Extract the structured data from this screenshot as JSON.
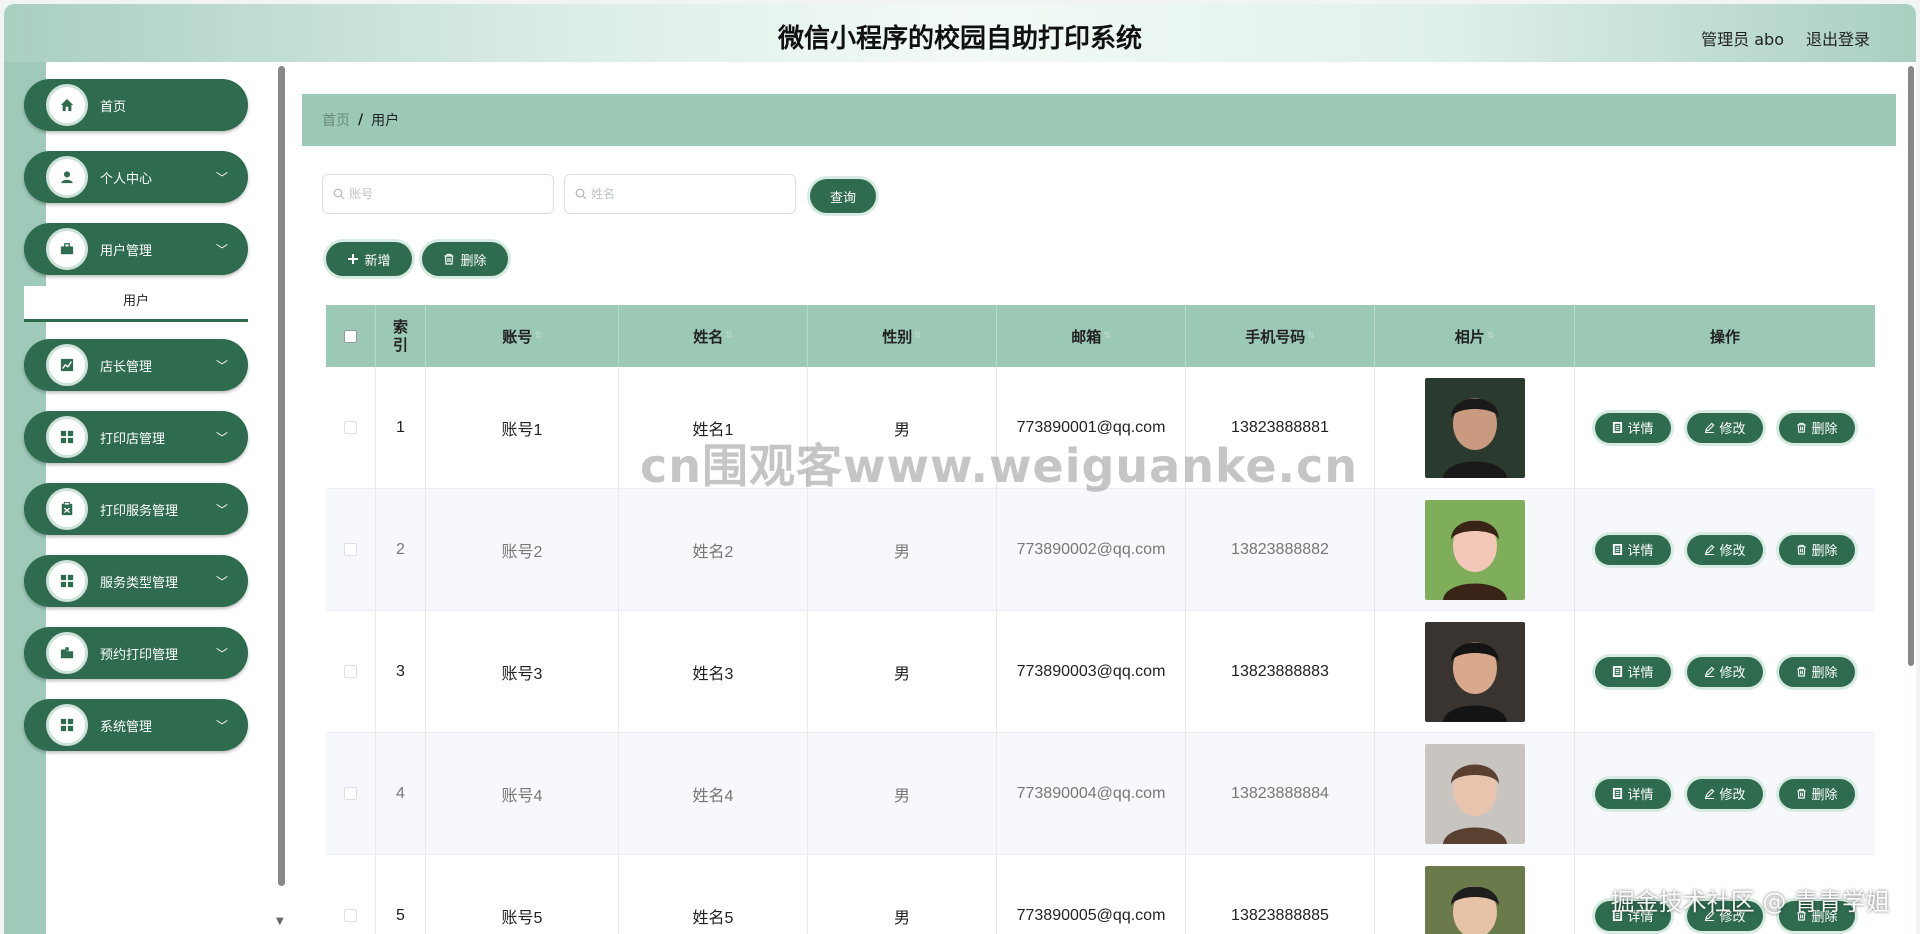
{
  "header": {
    "title": "微信小程序的校园自助打印系统",
    "user_label": "管理员 abo",
    "logout_label": "退出登录"
  },
  "sidebar": {
    "items": [
      {
        "label": "首页",
        "icon": "home-icon",
        "expandable": false
      },
      {
        "label": "个人中心",
        "icon": "user-icon",
        "expandable": true
      },
      {
        "label": "用户管理",
        "icon": "briefcase-icon",
        "expandable": true
      },
      {
        "label": "店长管理",
        "icon": "chart-icon",
        "expandable": true
      },
      {
        "label": "打印店管理",
        "icon": "grid-icon",
        "expandable": true
      },
      {
        "label": "打印服务管理",
        "icon": "clipboard-icon",
        "expandable": true
      },
      {
        "label": "服务类型管理",
        "icon": "grid-icon",
        "expandable": true
      },
      {
        "label": "预约打印管理",
        "icon": "folder-icon",
        "expandable": true
      },
      {
        "label": "系统管理",
        "icon": "grid-icon",
        "expandable": true
      }
    ],
    "active_sub": "用户"
  },
  "breadcrumb": {
    "home": "首页",
    "separator": "/",
    "current": "用户"
  },
  "search": {
    "account_placeholder": "账号",
    "name_placeholder": "姓名",
    "query_label": "查询"
  },
  "actions": {
    "add_label": "新增",
    "delete_label": "删除"
  },
  "table": {
    "columns": [
      "索引",
      "账号",
      "姓名",
      "性别",
      "邮箱",
      "手机号码",
      "相片",
      "操作"
    ],
    "rows": [
      {
        "index": "1",
        "account": "账号1",
        "name": "姓名1",
        "gender": "男",
        "email": "773890001@qq.com",
        "phone": "13823888881"
      },
      {
        "index": "2",
        "account": "账号2",
        "name": "姓名2",
        "gender": "男",
        "email": "773890002@qq.com",
        "phone": "13823888882"
      },
      {
        "index": "3",
        "account": "账号3",
        "name": "姓名3",
        "gender": "男",
        "email": "773890003@qq.com",
        "phone": "13823888883"
      },
      {
        "index": "4",
        "account": "账号4",
        "name": "姓名4",
        "gender": "男",
        "email": "773890004@qq.com",
        "phone": "13823888884"
      },
      {
        "index": "5",
        "account": "账号5",
        "name": "姓名5",
        "gender": "男",
        "email": "773890005@qq.com",
        "phone": "13823888885"
      }
    ],
    "row_actions": {
      "detail": "详情",
      "edit": "修改",
      "delete": "删除"
    }
  },
  "watermark": "cn围观客www.weiguanke.cn",
  "corner_mark": "掘金技术社区 @ 青青学姐",
  "colors": {
    "primary": "#2e6b4f",
    "header_bg": "#9cc9b6",
    "strip": "#9fc9b9"
  }
}
